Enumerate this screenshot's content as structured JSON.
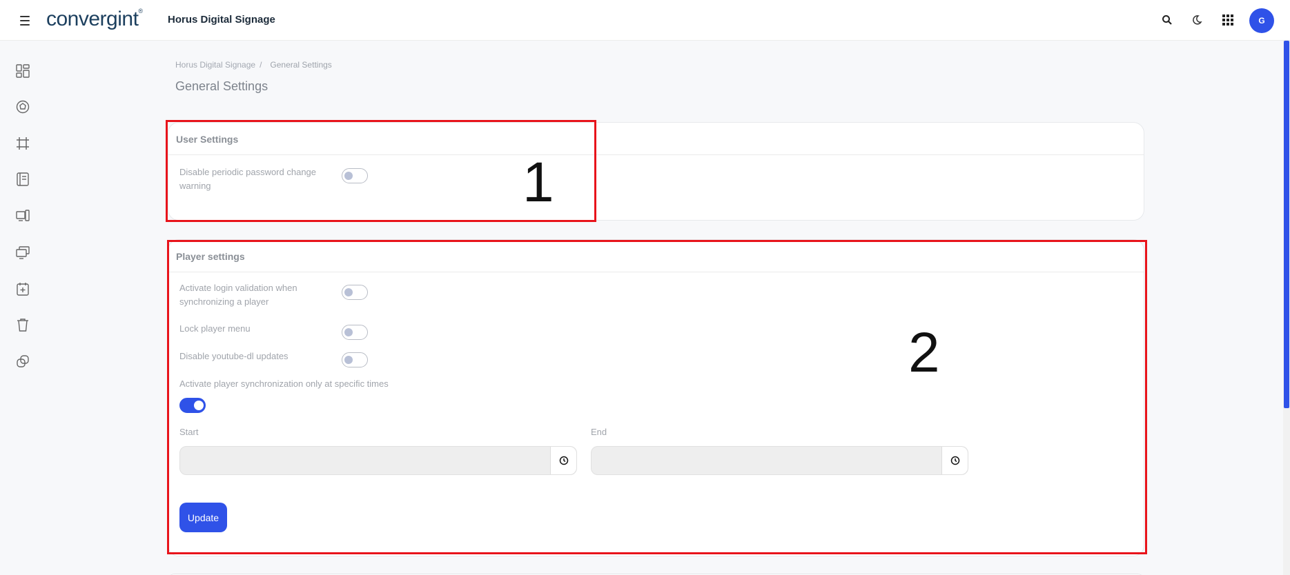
{
  "header": {
    "logo_text": "convergint",
    "logo_mark": "®",
    "app_title": "Horus Digital Signage",
    "avatar_initial": "G",
    "icons": [
      "search-icon",
      "moon-icon",
      "apps-grid-icon"
    ]
  },
  "sidebar": {
    "icons": [
      "dashboard-icon",
      "assets-icon",
      "layout-icon",
      "content-icon",
      "devices-icon",
      "screens-icon",
      "schedule-icon",
      "trash-icon",
      "links-icon"
    ]
  },
  "breadcrumb": {
    "root": "Horus Digital Signage",
    "separator": "/",
    "current": "General Settings"
  },
  "page": {
    "title": "General Settings"
  },
  "user_settings": {
    "title": "User Settings",
    "disable_password_warning": {
      "label": "Disable periodic password change warning",
      "enabled": false
    }
  },
  "player_settings": {
    "title": "Player settings",
    "login_validation": {
      "label": "Activate login validation when synchronizing a player",
      "enabled": false
    },
    "lock_menu": {
      "label": "Lock player menu",
      "enabled": false
    },
    "disable_youtube_dl": {
      "label": "Disable youtube-dl updates",
      "enabled": false
    },
    "sync_specific_times": {
      "label": "Activate player synchronization only at specific times",
      "enabled": true
    },
    "start": {
      "label": "Start",
      "value": ""
    },
    "end": {
      "label": "End",
      "value": ""
    },
    "update_label": "Update"
  },
  "annotations": {
    "box1": "1",
    "box2": "2"
  },
  "colors": {
    "accent": "#2f52e8",
    "annotation": "#e8141b"
  }
}
